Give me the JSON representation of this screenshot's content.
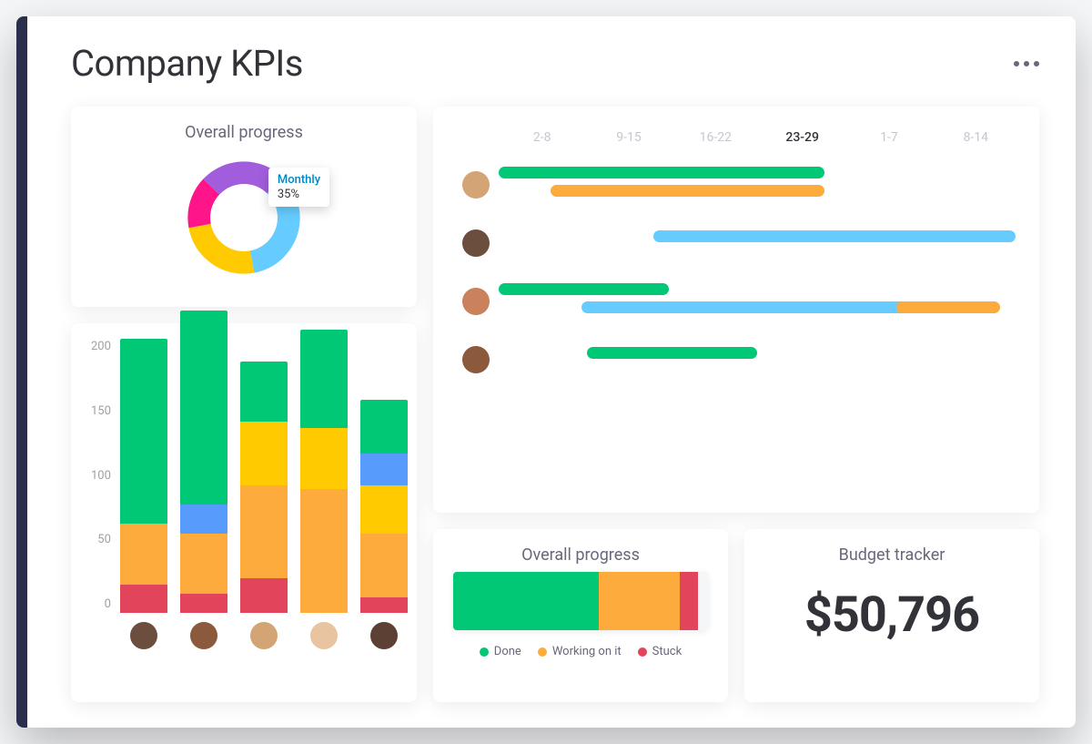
{
  "header": {
    "title": "Company KPIs"
  },
  "colors": {
    "green": "#00c875",
    "orange": "#fdab3d",
    "yellow": "#ffcb00",
    "red": "#e2445c",
    "pink": "#ff158a",
    "purple": "#a25ddc",
    "sky": "#66ccff",
    "blue": "#579bfc"
  },
  "chart_data": [
    {
      "id": "overall_progress_donut",
      "type": "pie",
      "title": "Overall progress",
      "slices": [
        {
          "label": "Monthly",
          "value": 35,
          "color": "#66ccff"
        },
        {
          "label": "",
          "value": 25,
          "color": "#ffcb00"
        },
        {
          "label": "",
          "value": 15,
          "color": "#ff158a"
        },
        {
          "label": "",
          "value": 25,
          "color": "#a25ddc"
        }
      ],
      "tooltip": {
        "label": "Monthly",
        "value": "35%"
      },
      "donut_hole": 0.55
    },
    {
      "id": "stacked_bars",
      "type": "bar",
      "stacked": true,
      "title": "",
      "y_ticks": [
        200,
        150,
        100,
        50,
        0
      ],
      "ylim": [
        0,
        200
      ],
      "categories": [
        "person1",
        "person2",
        "person3",
        "person4",
        "person5"
      ],
      "segment_order": [
        "red",
        "orange",
        "yellow",
        "blue",
        "green"
      ],
      "segment_colors": {
        "red": "#e2445c",
        "orange": "#fdab3d",
        "yellow": "#ffcb00",
        "blue": "#579bfc",
        "green": "#00c875"
      },
      "series": [
        {
          "red": 18,
          "orange": 38,
          "yellow": 0,
          "blue": 0,
          "green": 116
        },
        {
          "red": 12,
          "orange": 38,
          "yellow": 0,
          "blue": 18,
          "green": 122
        },
        {
          "red": 22,
          "orange": 58,
          "yellow": 40,
          "blue": 0,
          "green": 38
        },
        {
          "red": 0,
          "orange": 78,
          "yellow": 38,
          "blue": 0,
          "green": 62
        },
        {
          "red": 10,
          "orange": 40,
          "yellow": 30,
          "blue": 20,
          "green": 34
        }
      ],
      "avatar_colors": [
        "#6b4e3d",
        "#8b5a3c",
        "#d4a574",
        "#e8c5a0",
        "#5c4033"
      ]
    },
    {
      "id": "gantt_timeline",
      "type": "gantt",
      "title": "",
      "columns": [
        "2-8",
        "9-15",
        "16-22",
        "23-29",
        "1-7",
        "8-14"
      ],
      "active_column": "23-29",
      "rows": [
        {
          "avatar_color": "#d4a574",
          "bars": [
            {
              "start": 0.0,
              "end": 0.63,
              "color": "#00c875",
              "y": 0
            },
            {
              "start": 0.1,
              "end": 0.63,
              "color": "#fdab3d",
              "y": 1
            }
          ]
        },
        {
          "avatar_color": "#6b4e3d",
          "bars": [
            {
              "start": 0.3,
              "end": 1.0,
              "color": "#66ccff",
              "y": 0
            }
          ]
        },
        {
          "avatar_color": "#c9825c",
          "bars": [
            {
              "start": 0.0,
              "end": 0.33,
              "color": "#00c875",
              "y": 0
            },
            {
              "start": 0.16,
              "end": 0.85,
              "color": "#66ccff",
              "y": 1
            },
            {
              "start": 0.77,
              "end": 0.97,
              "color": "#fdab3d",
              "y": 1
            }
          ]
        },
        {
          "avatar_color": "#8b5a3c",
          "bars": [
            {
              "start": 0.17,
              "end": 0.5,
              "color": "#00c875",
              "y": 0
            }
          ]
        }
      ]
    },
    {
      "id": "overall_progress_bar",
      "type": "bar",
      "title": "Overall progress",
      "segments": [
        {
          "label": "Done",
          "value": 57,
          "color": "#00c875"
        },
        {
          "label": "Working on it",
          "value": 32,
          "color": "#fdab3d"
        },
        {
          "label": "Stuck",
          "value": 7,
          "color": "#e2445c"
        },
        {
          "label": "",
          "value": 4,
          "color": "#f5f6f8"
        }
      ],
      "legend": [
        {
          "label": "Done",
          "color": "#00c875"
        },
        {
          "label": "Working on it",
          "color": "#fdab3d"
        },
        {
          "label": "Stuck",
          "color": "#e2445c"
        }
      ]
    }
  ],
  "budget": {
    "title": "Budget tracker",
    "value": "$50,796"
  }
}
